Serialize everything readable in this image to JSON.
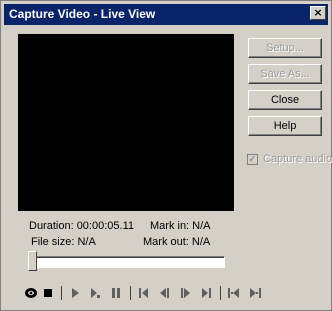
{
  "window": {
    "title": "Capture Video - Live View",
    "close_glyph": "×"
  },
  "buttons": {
    "setup": "Setup...",
    "save_as": "Save As...",
    "close": "Close",
    "help": "Help"
  },
  "capture_audio": {
    "label": "Capture audio",
    "checked": true,
    "enabled": false,
    "check_glyph": "✓"
  },
  "info": {
    "duration": "Duration: 00:00:05.11",
    "mark_in": "Mark in: N/A",
    "file_size": "File size: N/A",
    "mark_out": "Mark out: N/A"
  },
  "slider": {
    "position": 0
  },
  "transport": [
    "record-icon",
    "stop-icon",
    "play-icon",
    "step-play-icon",
    "pause-icon",
    "go-to-start-icon",
    "previous-frame-icon",
    "next-frame-icon",
    "go-to-end-icon",
    "mark-in-icon",
    "mark-out-icon"
  ],
  "colors": {
    "titlebar": "#0a246a",
    "face": "#d4d0c8",
    "video": "#000000"
  }
}
